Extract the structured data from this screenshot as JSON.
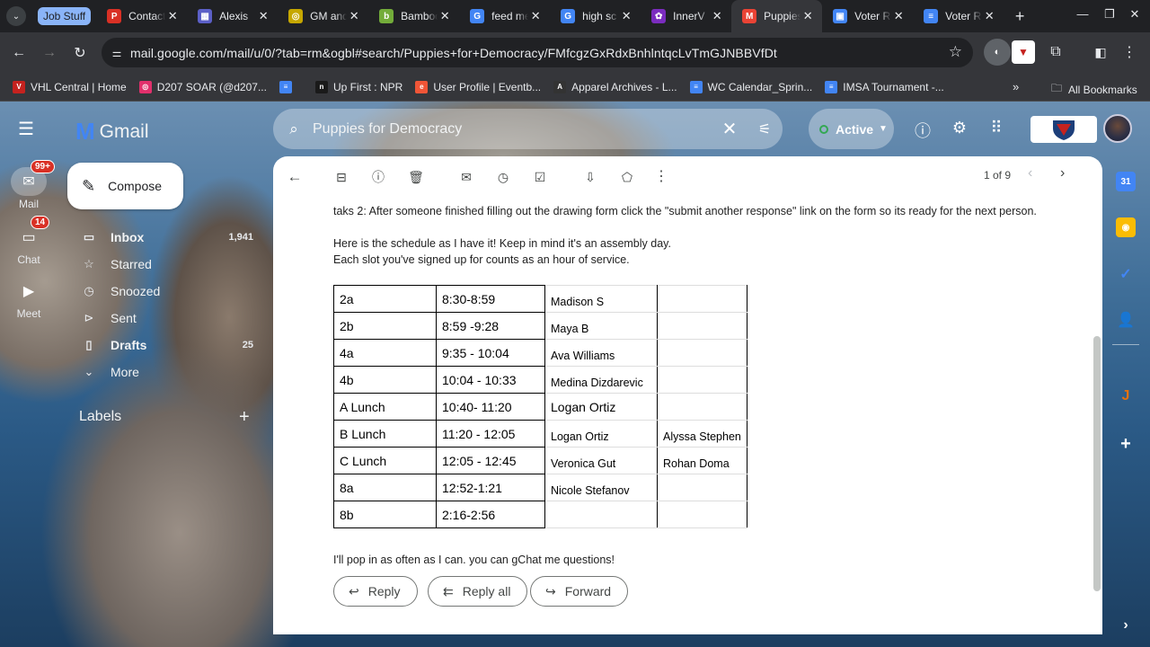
{
  "browser": {
    "tab_group": "Job Stuff",
    "tabs": [
      {
        "title": "Contact",
        "color": "#d93025",
        "glyph": "P"
      },
      {
        "title": "Alexis",
        "color": "#5b5fc7",
        "glyph": "▦"
      },
      {
        "title": "GM and",
        "color": "#c6a700",
        "glyph": "◎"
      },
      {
        "title": "Bamboo",
        "color": "#73ac3a",
        "glyph": "b"
      },
      {
        "title": "feed me",
        "color": "#4285f4",
        "glyph": "G"
      },
      {
        "title": "high sc",
        "color": "#4285f4",
        "glyph": "G"
      },
      {
        "title": "InnerV",
        "color": "#7b2cbf",
        "glyph": "✿"
      },
      {
        "title": "Puppies",
        "color": "#ea4335",
        "glyph": "M"
      },
      {
        "title": "Voter R",
        "color": "#4285f4",
        "glyph": "▣"
      },
      {
        "title": "Voter R",
        "color": "#4285f4",
        "glyph": "≡"
      }
    ],
    "url": "mail.google.com/mail/u/0/?tab=rm&ogbl#search/Puppies+for+Democracy/FMfcgzGxRdxBnhlntqcLvTmGJNBBVfDt",
    "bookmarks": [
      {
        "label": "VHL Central | Home",
        "color": "#c5221f",
        "glyph": "V"
      },
      {
        "label": "D207 SOAR (@d207...",
        "color": "#e1306c",
        "glyph": "◎"
      },
      {
        "label": "",
        "color": "#4285f4",
        "glyph": "≡"
      },
      {
        "label": "Up First : NPR",
        "color": "#1a1a1a",
        "glyph": "n"
      },
      {
        "label": "User Profile | Eventb...",
        "color": "#f05537",
        "glyph": "e"
      },
      {
        "label": "Apparel Archives - L...",
        "color": "#333333",
        "glyph": "A"
      },
      {
        "label": "WC Calendar_Sprin...",
        "color": "#4285f4",
        "glyph": "≡"
      },
      {
        "label": "IMSA Tournament -...",
        "color": "#4285f4",
        "glyph": "≡"
      }
    ],
    "all_bookmarks": "All Bookmarks"
  },
  "gmail": {
    "app_name": "Gmail",
    "search_query": "Puppies for Democracy",
    "status": "Active",
    "rail": [
      {
        "label": "Mail",
        "badge": "99+"
      },
      {
        "label": "Chat",
        "badge": "14"
      },
      {
        "label": "Meet",
        "badge": ""
      }
    ],
    "compose": "Compose",
    "nav": [
      {
        "label": "Inbox",
        "count": "1,941",
        "icon": "inbox-icon"
      },
      {
        "label": "Starred",
        "count": "",
        "icon": "star-icon"
      },
      {
        "label": "Snoozed",
        "count": "",
        "icon": "clock-icon"
      },
      {
        "label": "Sent",
        "count": "",
        "icon": "send-icon"
      },
      {
        "label": "Drafts",
        "count": "25",
        "icon": "draft-icon"
      },
      {
        "label": "More",
        "count": "",
        "icon": "chevron-down-icon"
      }
    ],
    "labels_heading": "Labels",
    "pager": "1 of 9"
  },
  "email": {
    "line_task": "taks 2: After someone finished filling out the drawing form click the \"submit another response\" link on the form so its ready for the next person.",
    "line_schedule_1": "Here is the schedule as I have it!  Keep in mind it's an assembly day.",
    "line_schedule_2": "Each slot you've signed up for counts as an hour of service.",
    "schedule": [
      {
        "period": "2a",
        "time": "8:30-8:59",
        "vol1": "Madison S",
        "vol2": ""
      },
      {
        "period": "2b",
        "time": "8:59 -9:28",
        "vol1": "Maya B",
        "vol2": ""
      },
      {
        "period": "4a",
        "time": "9:35 - 10:04",
        "vol1": "Ava Williams",
        "vol2": ""
      },
      {
        "period": "4b",
        "time": "10:04 - 10:33",
        "vol1": "Medina Dizdarevic",
        "vol2": ""
      },
      {
        "period": "A Lunch",
        "time": "10:40- 11:20",
        "vol1": "Logan Ortiz",
        "vol2": ""
      },
      {
        "period": "B Lunch",
        "time": "11:20 - 12:05",
        "vol1": "Logan Ortiz",
        "vol2": "Alyssa Stephen"
      },
      {
        "period": "C Lunch",
        "time": "12:05 - 12:45",
        "vol1": "Veronica Gut",
        "vol2": "Rohan Doma"
      },
      {
        "period": "8a",
        "time": "12:52-1:21",
        "vol1": "Nicole Stefanov",
        "vol2": ""
      },
      {
        "period": "8b",
        "time": "2:16-2:56",
        "vol1": "",
        "vol2": ""
      }
    ],
    "closing": "I'll pop in as often as I can.  you can gChat me questions!",
    "reply": "Reply",
    "reply_all": "Reply all",
    "forward": "Forward"
  }
}
